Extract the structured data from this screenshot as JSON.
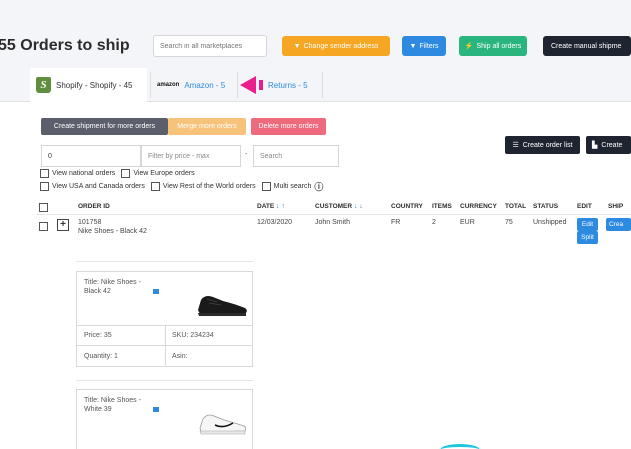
{
  "header": {
    "title": "55 Orders to ship",
    "search_placeholder": "Search in all marketplaces",
    "buttons": {
      "change_sender": "Change sender address",
      "filters": "Filters",
      "ship_all": "Ship all orders",
      "create_manual": "Create manual shipme"
    }
  },
  "tabs": [
    {
      "label": "Shopify - Shopify - 45",
      "icon": "shopify-logo"
    },
    {
      "label": "Amazon - 5",
      "logo": "amazon"
    },
    {
      "label": "Returns - 5",
      "icon": "returns-arrow"
    }
  ],
  "actions": {
    "create_shipment": "Create shipment for more orders",
    "merge": "Merge more orders",
    "delete": "Delete more orders"
  },
  "filters": {
    "price_min_value": "0",
    "price_max_placeholder": "Filter by price - max",
    "dash": "-",
    "search_placeholder": "Search",
    "create_order_list": "Create order list",
    "create": "Create",
    "checkboxes_row1": [
      "View national orders",
      "View Europe orders"
    ],
    "checkboxes_row2": [
      "View USA and Canada orders",
      "View Rest of the World orders",
      "Multi search"
    ]
  },
  "table": {
    "headers": [
      "ORDER ID",
      "DATE",
      "CUSTOMER",
      "COUNTRY",
      "ITEMS",
      "CURRENCY",
      "TOTAL",
      "STATUS",
      "EDIT",
      "SHIP"
    ],
    "rows": [
      {
        "order_id": "101758",
        "product": "Nike Shoes - Black 42",
        "date": "12/03/2020",
        "customer": "John Smith",
        "country": "FR",
        "items": "2",
        "currency": "EUR",
        "total": "75",
        "status": "Unshipped",
        "edit_label": "Edit",
        "split_label": "Split",
        "ship_label": "Crea"
      }
    ]
  },
  "products": [
    {
      "title": "Title: Nike Shoes - Black 42",
      "price": "Price: 35",
      "sku": "SKU: 234234",
      "quantity": "Quantity: 1",
      "asin": "Asin:"
    },
    {
      "title": "Title: Nike Shoes - White 39"
    }
  ],
  "colors": {
    "orange": "#f5a623",
    "blue": "#2d8ae0",
    "green": "#2bb57e",
    "dark": "#1f2530",
    "pink": "#e91e8c",
    "red": "#ee6a7c"
  }
}
